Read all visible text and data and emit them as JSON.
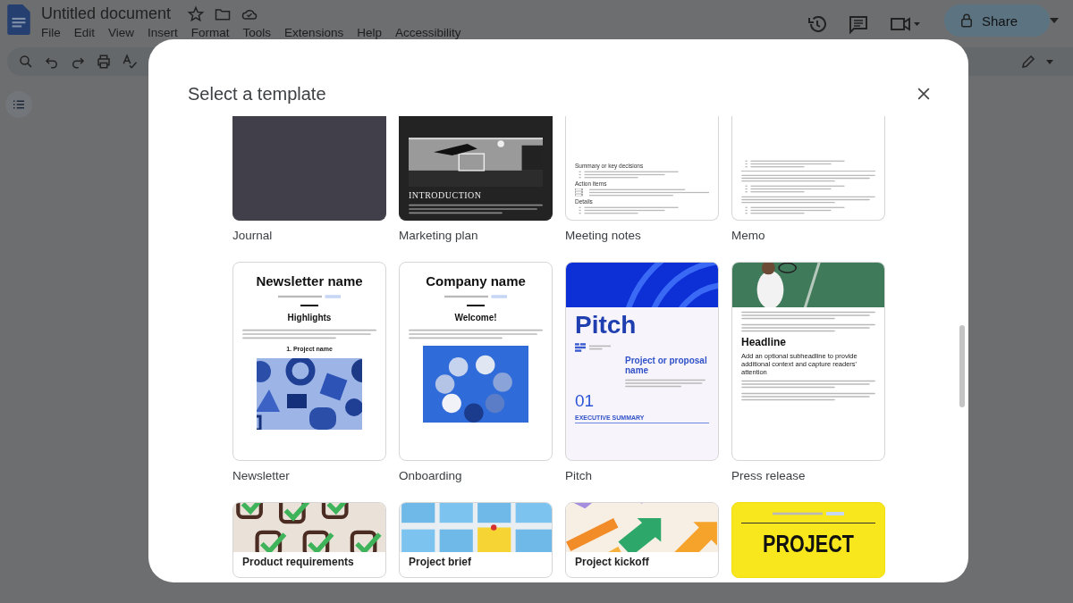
{
  "document": {
    "title": "Untitled document"
  },
  "menu": [
    "File",
    "Edit",
    "View",
    "Insert",
    "Format",
    "Tools",
    "Extensions",
    "Help",
    "Accessibility"
  ],
  "share": {
    "label": "Share"
  },
  "dialog": {
    "title": "Select a template",
    "templates": [
      {
        "label": "Journal",
        "kind": "journal"
      },
      {
        "label": "Marketing plan",
        "kind": "marketing",
        "blocks": [
          {
            "kind": "picture"
          },
          {
            "kind": "serif-heading",
            "text": "INTRODUCTION"
          },
          {
            "kind": "lines"
          }
        ]
      },
      {
        "label": "Meeting notes",
        "kind": "meeting",
        "blocks": [
          {
            "kind": "heading",
            "text": "Summary or key decisions"
          },
          {
            "kind": "bullets"
          },
          {
            "kind": "heading",
            "text": "Action items"
          },
          {
            "kind": "checks"
          },
          {
            "kind": "heading",
            "text": "Details"
          },
          {
            "kind": "bullets"
          }
        ]
      },
      {
        "label": "Memo",
        "kind": "memo",
        "blocks": [
          {
            "kind": "bullets"
          },
          {
            "kind": "rule"
          },
          {
            "kind": "lines"
          },
          {
            "kind": "bullets"
          },
          {
            "kind": "lines"
          },
          {
            "kind": "bullets"
          }
        ]
      },
      {
        "label": "Newsletter",
        "kind": "newsletter",
        "blocks": [
          {
            "kind": "title",
            "text": "Newsletter name"
          },
          {
            "kind": "tagline"
          },
          {
            "kind": "rule"
          },
          {
            "kind": "heading",
            "text": "Highlights"
          },
          {
            "kind": "lines"
          },
          {
            "kind": "subheading",
            "text": "1. Project name"
          },
          {
            "kind": "picture"
          }
        ]
      },
      {
        "label": "Onboarding",
        "kind": "onboarding",
        "blocks": [
          {
            "kind": "title",
            "text": "Company name"
          },
          {
            "kind": "tagline"
          },
          {
            "kind": "rule"
          },
          {
            "kind": "heading",
            "text": "Welcome!"
          },
          {
            "kind": "lines"
          },
          {
            "kind": "picture"
          }
        ]
      },
      {
        "label": "Pitch",
        "kind": "pitch",
        "blocks": [
          {
            "kind": "picture"
          },
          {
            "kind": "title",
            "text": "Pitch"
          },
          {
            "kind": "logo"
          },
          {
            "kind": "heading",
            "text": "Project or proposal name"
          },
          {
            "kind": "lines"
          },
          {
            "kind": "number",
            "text": "01"
          },
          {
            "kind": "caption",
            "text": "EXECUTIVE SUMMARY"
          }
        ]
      },
      {
        "label": "Press release",
        "kind": "press",
        "blocks": [
          {
            "kind": "picture"
          },
          {
            "kind": "lines"
          },
          {
            "kind": "lines"
          },
          {
            "kind": "title",
            "text": "Headline"
          },
          {
            "kind": "subheading",
            "text": "Add an optional subheadline to provide additional context and capture readers' attention"
          },
          {
            "kind": "lines"
          },
          {
            "kind": "lines"
          }
        ]
      },
      {
        "kind": "requirements",
        "blocks": [
          {
            "kind": "picture"
          },
          {
            "kind": "title",
            "text": "Product requirements"
          }
        ]
      },
      {
        "kind": "brief",
        "blocks": [
          {
            "kind": "picture"
          },
          {
            "kind": "title",
            "text": "Project brief"
          }
        ]
      },
      {
        "kind": "kickoff",
        "blocks": [
          {
            "kind": "picture"
          },
          {
            "kind": "title",
            "text": "Project kickoff"
          }
        ]
      },
      {
        "kind": "project",
        "blocks": [
          {
            "kind": "tagline"
          },
          {
            "kind": "rule"
          },
          {
            "kind": "display",
            "text": "PROJECT"
          }
        ]
      }
    ]
  }
}
